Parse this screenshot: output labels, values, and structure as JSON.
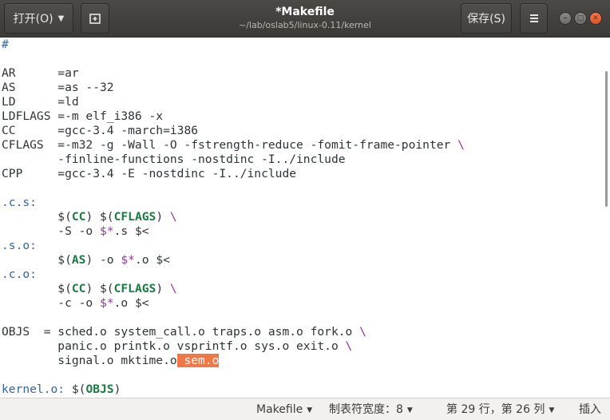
{
  "header": {
    "open_label": "打开(O)",
    "title": "*Makefile",
    "path": "~/lab/oslab5/linux-0.11/kernel",
    "save_label": "保存(S)",
    "new_tab_icon": "new-tab-icon",
    "menu_icon": "hamburger-menu-icon"
  },
  "editor": {
    "lines": [
      "#",
      "",
      "AR      =ar",
      "AS      =as --32",
      "LD      =ld",
      "LDFLAGS =-m elf_i386 -x",
      "CC      =gcc-3.4 -march=i386",
      "CFLAGS  =-m32 -g -Wall -O -fstrength-reduce -fomit-frame-pointer \\",
      "        -finline-functions -nostdinc -I../include",
      "CPP     =gcc-3.4 -E -nostdinc -I../include",
      "",
      ".c.s:",
      "        $(CC) $(CFLAGS) \\",
      "        -S -o $*.s $<",
      ".s.o:",
      "        $(AS) -o $*.o $<",
      ".c.o:",
      "        $(CC) $(CFLAGS) \\",
      "        -c -o $*.o $<",
      "",
      "OBJS  = sched.o system_call.o traps.o asm.o fork.o \\",
      "        panic.o printk.o vsprintf.o sys.o exit.o \\",
      "        signal.o mktime.o sem.o",
      "",
      "kernel.o: $(OBJS)"
    ],
    "selected_text": " sem.o"
  },
  "status": {
    "language": "Makefile",
    "tab_width": "制表符宽度：8",
    "position": "第 29 行，第 26 列",
    "mode": "插入"
  },
  "colors": {
    "header_bg": "#3b3a36",
    "keyword_green": "#1b7b40",
    "target_blue": "#3465a4",
    "special_purple": "#9b2fae",
    "selection": "#f07746"
  }
}
